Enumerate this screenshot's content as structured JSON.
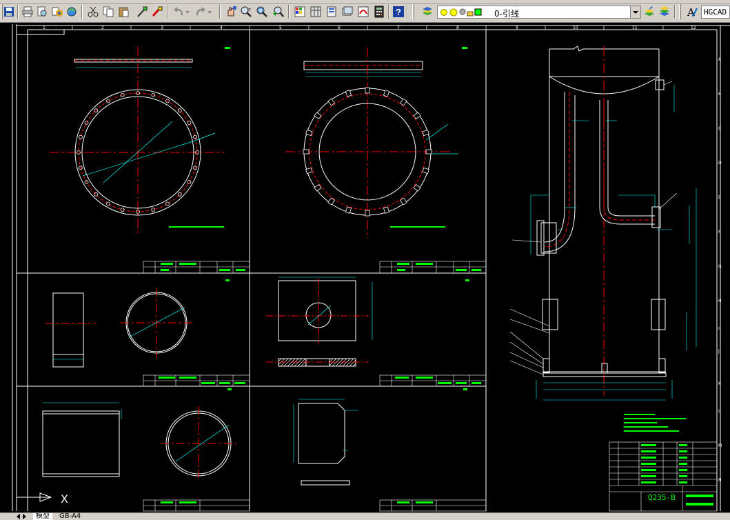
{
  "toolbar": {
    "layer_name": "0-引线",
    "font_name": "HGCAD",
    "buttons": [
      "save",
      "print",
      "preview",
      "publish",
      "plot",
      "cut",
      "copy",
      "paste",
      "match-properties",
      "paintbrush",
      "undo",
      "redo",
      "pan",
      "zoom-realtime",
      "zoom-window",
      "zoom-previous",
      "properties",
      "design-center",
      "tool-palette",
      "sheet-set",
      "markup",
      "calculator",
      "help",
      "layer-manager",
      "layer-state",
      "layer-make-current",
      "layer-previous",
      "text-style"
    ]
  },
  "drawing": {
    "col_numbers": [
      "1",
      "2",
      "3",
      "4",
      "5",
      "6",
      "7",
      "8",
      "9",
      "10",
      "11",
      "12"
    ],
    "row_letters": [
      "A",
      "B",
      "C",
      "D",
      "E",
      "F",
      "G",
      "H",
      "I",
      "J",
      "K",
      "L",
      "M",
      "N"
    ],
    "material_text": "Q235-B",
    "tb_left_symbol": "X"
  },
  "status": {
    "model_tab": "模型",
    "layout_tab": "GB-A4"
  },
  "colors": {
    "background": "#000000",
    "outline": "#ffffff",
    "dimension": "#00ffff",
    "centerline": "#ff0000",
    "annotation": "#00ff00",
    "toolbar": "#d4d0c8"
  }
}
